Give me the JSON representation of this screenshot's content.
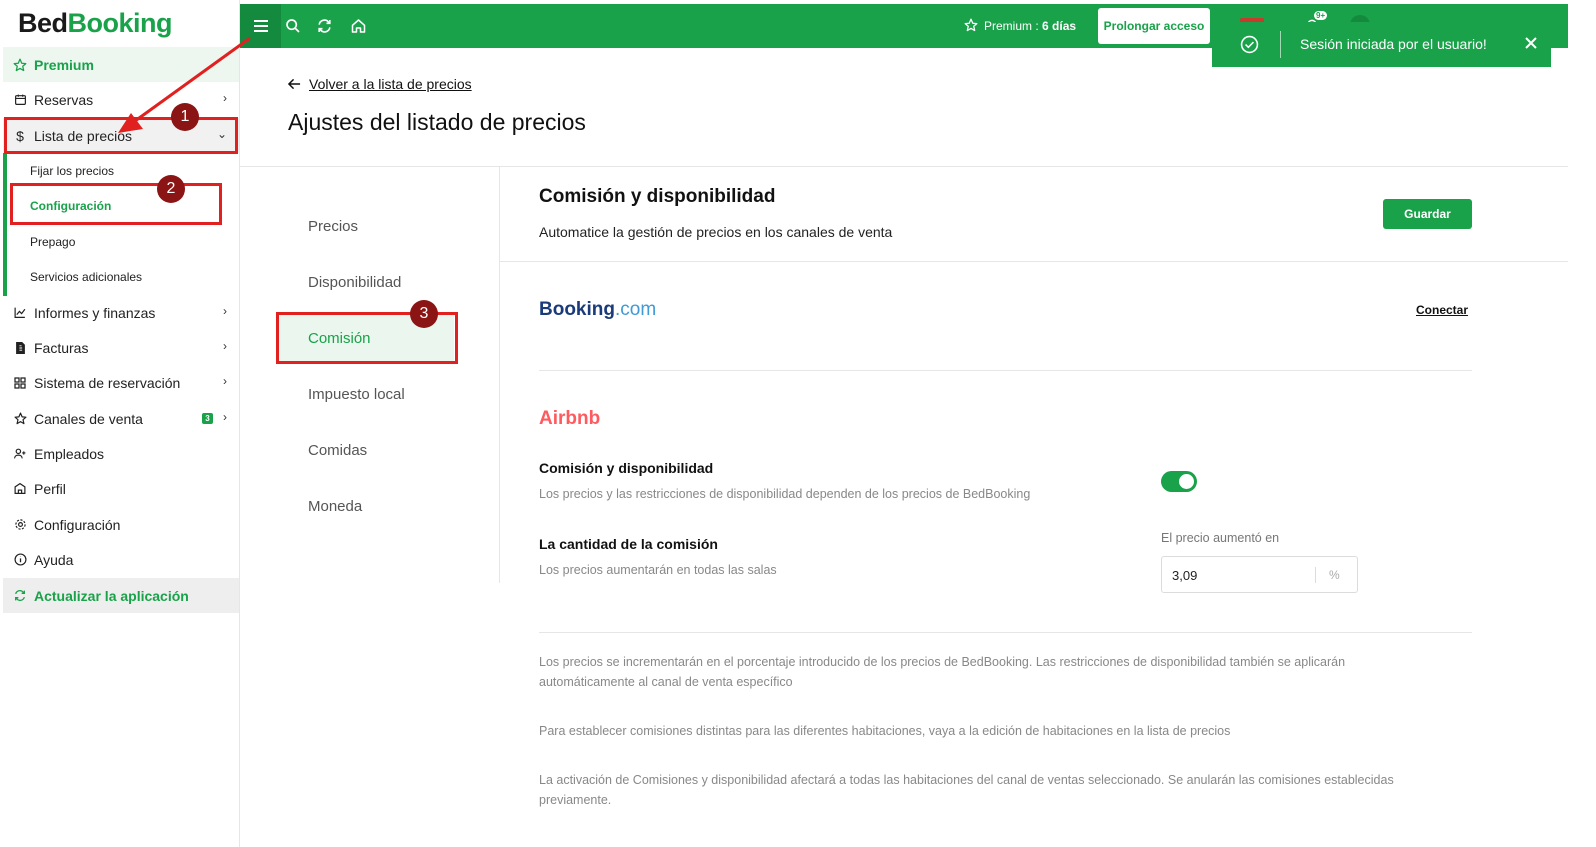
{
  "brand": {
    "part1": "Bed",
    "part2": "Booking"
  },
  "sidebar": {
    "premium": "Premium",
    "items": [
      {
        "label": "Reservas",
        "icon": "calendar-icon"
      },
      {
        "label": "Lista de precios",
        "icon": "dollar-icon"
      },
      {
        "label": "Informes y finanzas",
        "icon": "chart-icon"
      },
      {
        "label": "Facturas",
        "icon": "invoice-icon"
      },
      {
        "label": "Sistema de reservación",
        "icon": "grid-icon"
      },
      {
        "label": "Canales de venta",
        "icon": "star-icon",
        "badge": "3"
      },
      {
        "label": "Empleados",
        "icon": "user-add-icon"
      },
      {
        "label": "Perfil",
        "icon": "building-icon"
      },
      {
        "label": "Configuración",
        "icon": "gear-icon"
      },
      {
        "label": "Ayuda",
        "icon": "info-icon"
      }
    ],
    "subitems": [
      "Fijar los precios",
      "Configuración",
      "Prepago",
      "Servicios adicionales"
    ],
    "update": "Actualizar la aplicación"
  },
  "topbar": {
    "premium_label": "Premium :",
    "premium_days": "6 días",
    "extend_button": "Prolongar acceso",
    "notif_count": "9+"
  },
  "toast": {
    "message": "Sesión iniciada por el usuario!"
  },
  "header": {
    "back_link": "Volver a la lista de precios",
    "title": "Ajustes del listado de precios"
  },
  "subnav": [
    "Precios",
    "Disponibilidad",
    "Comisión",
    "Impuesto local",
    "Comidas",
    "Moneda"
  ],
  "content": {
    "title": "Comisión y disponibilidad",
    "subtitle": "Automatice la gestión de precios en los canales de venta",
    "save_button": "Guardar",
    "booking": {
      "part1": "Booking",
      "part2": ".com",
      "connect": "Conectar"
    },
    "airbnb": {
      "name": "Airbnb",
      "sync_label": "Comisión y disponibilidad",
      "sync_help": "Los precios y las restricciones de disponibilidad dependen de los precios de BedBooking",
      "sync_enabled": true,
      "commission_label": "La cantidad de la comisión",
      "commission_help": "Los precios aumentarán en todas las salas",
      "increase_label": "El precio aumentó en",
      "increase_value": "3,09",
      "increase_unit": "%"
    },
    "notes": [
      "Los precios se incrementarán en el porcentaje introducido de los precios de BedBooking. Las restricciones de disponibilidad también se aplicarán automáticamente al canal de venta específico",
      "Para establecer comisiones distintas para las diferentes habitaciones, vaya a la edición de habitaciones en la lista de precios",
      "La activación de Comisiones y disponibilidad afectará a todas las habitaciones del canal de ventas seleccionado. Se anularán las comisiones establecidas previamente."
    ]
  },
  "annotations": [
    "1",
    "2",
    "3"
  ],
  "colors": {
    "brand_green": "#19a24a",
    "annotation_red": "#e0211f",
    "airbnb": "#ff5a5f",
    "booking_blue": "#1a3a7a"
  }
}
